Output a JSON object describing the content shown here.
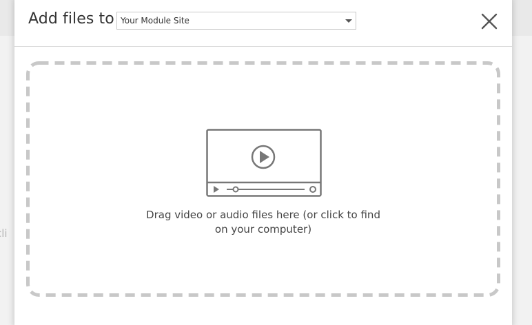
{
  "background": {
    "partial_text": "cli"
  },
  "modal": {
    "title": "Add files to",
    "site_select": {
      "value": "Your Module Site"
    },
    "close_icon": "close-icon",
    "drop_zone": {
      "icon": "video-player-icon",
      "text_line1": "Drag video or audio files here (or click to find",
      "text_line2": "on your computer)"
    }
  },
  "colors": {
    "dashed_border": "#c8c8c8",
    "icon": "#777777",
    "text": "#444444"
  }
}
